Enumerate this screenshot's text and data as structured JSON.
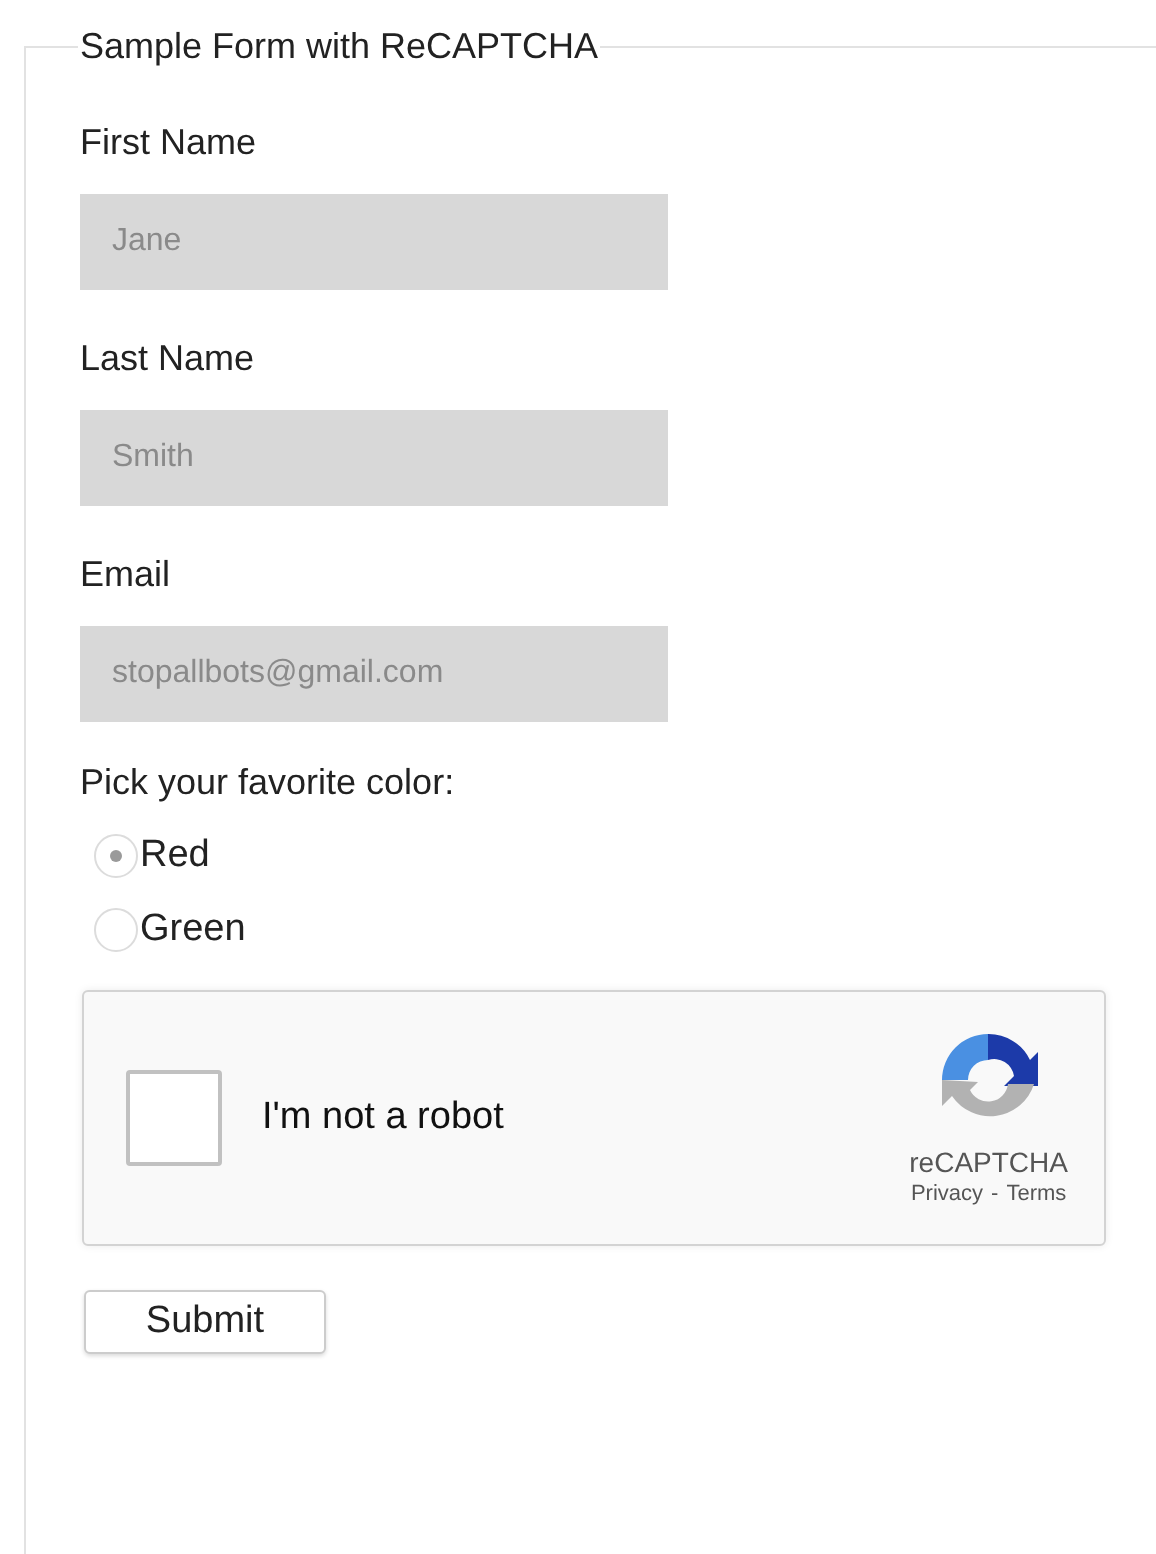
{
  "form": {
    "legend": "Sample Form with ReCAPTCHA",
    "fields": [
      {
        "label": "First Name",
        "placeholder": "Jane"
      },
      {
        "label": "Last Name",
        "placeholder": "Smith"
      },
      {
        "label": "Email",
        "placeholder": "stopallbots@gmail.com"
      }
    ],
    "color_question": "Pick your favorite color:",
    "options": [
      {
        "label": "Red",
        "selected": true
      },
      {
        "label": "Green",
        "selected": false
      }
    ],
    "captcha": {
      "label": "I'm not a robot",
      "checked": false,
      "brand": "reCAPTCHA",
      "privacy": "Privacy",
      "separator": "-",
      "terms": "Terms"
    },
    "submit": "Submit"
  }
}
